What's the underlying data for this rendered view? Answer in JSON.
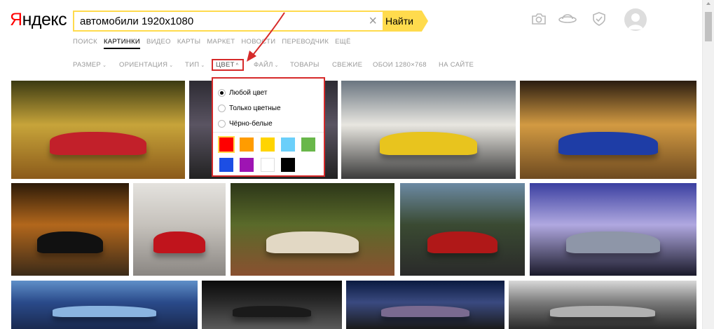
{
  "logo": {
    "first": "Я",
    "rest": "ндекс"
  },
  "search": {
    "value": "автомобили 1920x1080",
    "clear_glyph": "×",
    "button": "Найти"
  },
  "header_icons": [
    "camera-icon",
    "saturn-icon",
    "shield-icon"
  ],
  "nav": [
    "ПОИСК",
    "КАРТИНКИ",
    "ВИДЕО",
    "КАРТЫ",
    "МАРКЕТ",
    "НОВОСТИ",
    "ПЕРЕВОДЧИК",
    "ЕЩЁ"
  ],
  "nav_active": "КАРТИНКИ",
  "filters": {
    "size": "РАЗМЕР",
    "orientation": "ОРИЕНТАЦИЯ",
    "type": "ТИП",
    "color": "ЦВЕТ",
    "file": "ФАЙЛ",
    "goods": "ТОВАРЫ",
    "fresh": "СВЕЖИЕ",
    "wallpaper": "ОБОИ 1280×768",
    "site": "НА САЙТЕ",
    "caret": "⌄",
    "caret_up": "^"
  },
  "color_menu": {
    "options": [
      "Любой цвет",
      "Только цветные",
      "Чёрно-белые"
    ],
    "selected_index": 0,
    "swatches": [
      {
        "name": "red",
        "hex": "#ff0000"
      },
      {
        "name": "orange",
        "hex": "#ff9c00"
      },
      {
        "name": "yellow",
        "hex": "#ffd400"
      },
      {
        "name": "cyan",
        "hex": "#6bcffa"
      },
      {
        "name": "green",
        "hex": "#69b74a"
      },
      {
        "name": "blue",
        "hex": "#1c4ee4"
      },
      {
        "name": "violet",
        "hex": "#9e14b3"
      },
      {
        "name": "white",
        "hex": "#ffffff"
      },
      {
        "name": "black",
        "hex": "#000000"
      }
    ],
    "selected_swatch": 0
  },
  "images": [
    {
      "name": "red-sports-car-autumn",
      "colors": [
        "#3b3a12",
        "#c7a43a",
        "#8b5a1a",
        "#c2202a"
      ]
    },
    {
      "name": "blue-car-partial",
      "colors": [
        "#2d2b33",
        "#5a5462",
        "#222",
        "#1a3da0"
      ]
    },
    {
      "name": "yellow-and-red-supercars",
      "colors": [
        "#6a7580",
        "#e8e6e0",
        "#3a3a3a",
        "#e8c41e"
      ]
    },
    {
      "name": "blue-mustang-sunset",
      "colors": [
        "#2a1c10",
        "#d29a42",
        "#6e4a20",
        "#1e3da6"
      ]
    },
    {
      "name": "black-gtr-autumn",
      "colors": [
        "#2c1a08",
        "#b2671c",
        "#3b2a18",
        "#111"
      ]
    },
    {
      "name": "red-ferrari-white",
      "colors": [
        "#e4e2de",
        "#c6c2bc",
        "#8a8682",
        "#c0141c"
      ]
    },
    {
      "name": "white-red-ferrari-trees",
      "colors": [
        "#2c3618",
        "#5a6a2a",
        "#8a5030",
        "#e2d8c4"
      ]
    },
    {
      "name": "red-mustang-hills",
      "colors": [
        "#6c8aa4",
        "#3a4a32",
        "#2a2a2a",
        "#b01818"
      ]
    },
    {
      "name": "silver-camaro-purple",
      "colors": [
        "#3a3fa0",
        "#b0a8e0",
        "#1a1a2a",
        "#8e96a8"
      ]
    },
    {
      "name": "sky-horizon",
      "colors": [
        "#5f8fc8",
        "#2a4a8a",
        "#1a2a50",
        "#8ab4e0"
      ]
    },
    {
      "name": "dark-garage",
      "colors": [
        "#0a0a0a",
        "#2a2a2a",
        "#5a5a5a",
        "#1a1a1a"
      ]
    },
    {
      "name": "car-night-city",
      "colors": [
        "#0a1a40",
        "#3a4a80",
        "#1a1a1a",
        "#7a6a90"
      ]
    },
    {
      "name": "sports-car-city-art",
      "colors": [
        "#d8d8d8",
        "#7a7a7a",
        "#2a2a2a",
        "#b0b0b0"
      ]
    }
  ],
  "colors": {
    "accent": "#ffdb4d",
    "highlight": "#d62a2a",
    "logo_red": "#ff0000"
  }
}
